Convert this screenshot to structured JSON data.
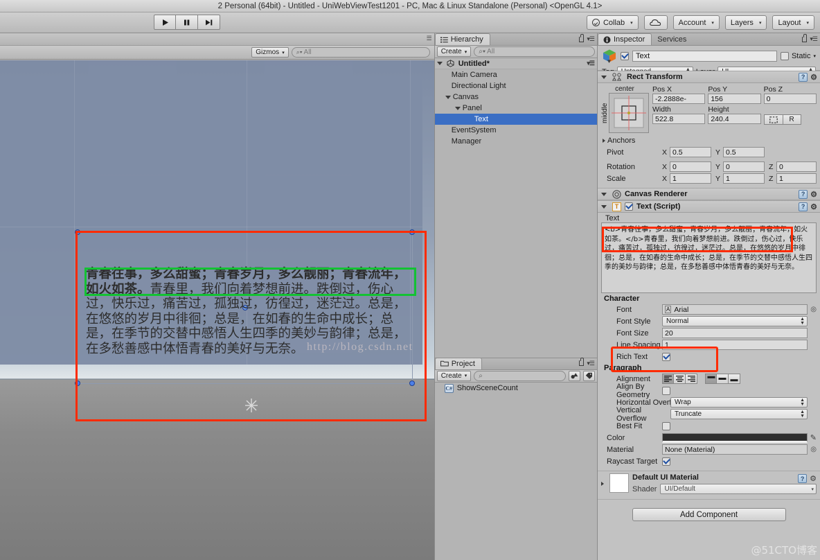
{
  "window": {
    "title": "2 Personal (64bit) - Untitled - UniWebViewTest1201 - PC, Mac & Linux Standalone (Personal) <OpenGL 4.1>"
  },
  "toolbar": {
    "play": "▶",
    "pause": "❙❙",
    "step": "▶❙",
    "collab": "Collab",
    "cloud_icon": "cloud-icon",
    "account": "Account",
    "layers": "Layers",
    "layout": "Layout",
    "caret": "▾"
  },
  "scene": {
    "gizmos": "Gizmos",
    "search_placeholder": "All",
    "search_prefix": "Q",
    "watermark": "http://blog.csdn.net",
    "text_bold": "青春往事，多么甜蜜；青春岁月，多么靓丽；青春流年，如火如茶。",
    "text_rest": "青春里，我们向着梦想前进。跌倒过，伤心过，快乐过，痛苦过，孤独过，彷徨过，迷茫过。总是，在悠悠的岁月中徘徊；总是，在如春的生命中成长；总是，在季节的交替中感悟人生四季的美妙与韵律；总是，在多愁善感中体悟青春的美好与无奈。"
  },
  "hierarchy": {
    "tab": "Hierarchy",
    "create": "Create",
    "search_placeholder": "All",
    "scene_name": "Untitled*",
    "items": [
      {
        "label": "Main Camera",
        "depth": 1,
        "expandable": false,
        "selected": false
      },
      {
        "label": "Directional Light",
        "depth": 1,
        "expandable": false,
        "selected": false
      },
      {
        "label": "Canvas",
        "depth": 1,
        "expandable": true,
        "selected": false
      },
      {
        "label": "Panel",
        "depth": 2,
        "expandable": true,
        "selected": false
      },
      {
        "label": "Text",
        "depth": 3,
        "expandable": false,
        "selected": true
      },
      {
        "label": "EventSystem",
        "depth": 1,
        "expandable": false,
        "selected": false
      },
      {
        "label": "Manager",
        "depth": 1,
        "expandable": false,
        "selected": false
      }
    ]
  },
  "project": {
    "tab": "Project",
    "create": "Create",
    "search_placeholder": "",
    "items": [
      {
        "label": "ShowSceneCount",
        "icon": "csharp-script-icon"
      }
    ]
  },
  "inspector": {
    "tab": "Inspector",
    "services_tab": "Services",
    "object_name": "Text",
    "object_enabled": true,
    "static_label": "Static",
    "tag_label": "Tag",
    "tag_value": "Untagged",
    "layer_label": "Layer",
    "layer_value": "UI",
    "rect_transform": {
      "title": "Rect Transform",
      "anchor_preset_top": "center",
      "anchor_preset_left": "middle",
      "headers": [
        "Pos X",
        "Pos Y",
        "Pos Z"
      ],
      "values": [
        "-2.2888e-",
        "156",
        "0"
      ],
      "size_headers": [
        "Width",
        "Height"
      ],
      "size_values": [
        "522.8",
        "240.4"
      ],
      "blueprint_label": "R",
      "anchors_label": "Anchors",
      "pivot_label": "Pivot",
      "pivot_x": "0.5",
      "pivot_y": "0.5",
      "rotation_label": "Rotation",
      "rotation": [
        "0",
        "0",
        "0"
      ],
      "scale_label": "Scale",
      "scale": [
        "1",
        "1",
        "1"
      ]
    },
    "canvas_renderer": {
      "title": "Canvas Renderer"
    },
    "text_script": {
      "title": "Text (Script)",
      "enabled": true,
      "text_label": "Text",
      "text_value": "<b>青春往事，多么甜蜜；青春岁月，多么靓丽；青春流年，如火如茶。</b>青春里，我们向着梦想前进。跌倒过，伤心过，快乐过，痛苦过，孤独过，彷徨过，迷茫过。总是，在悠悠的岁月中徘徊；总是，在如春的生命中成长；总是，在季节的交替中感悟人生四季的美妙与韵律；总是，在多愁善感中体悟青春的美好与无奈。",
      "character_label": "Character",
      "font_label": "Font",
      "font_value": "Arial",
      "font_style_label": "Font Style",
      "font_style_value": "Normal",
      "font_size_label": "Font Size",
      "font_size_value": "20",
      "line_spacing_label": "Line Spacing",
      "line_spacing_value": "1",
      "rich_text_label": "Rich Text",
      "rich_text_checked": true,
      "paragraph_label": "Paragraph",
      "alignment_label": "Alignment",
      "align_by_geometry_label": "Align By Geometry",
      "align_by_geometry_checked": false,
      "horizontal_overflow_label": "Horizontal Overflow",
      "horizontal_overflow_value": "Wrap",
      "vertical_overflow_label": "Vertical Overflow",
      "vertical_overflow_value": "Truncate",
      "best_fit_label": "Best Fit",
      "best_fit_checked": false,
      "color_label": "Color",
      "color_value": "#2e2e2e",
      "material_label": "Material",
      "material_value": "None (Material)",
      "raycast_target_label": "Raycast Target",
      "raycast_target_checked": true
    },
    "material_block": {
      "title": "Default UI Material",
      "shader_label": "Shader",
      "shader_value": "UI/Default"
    },
    "add_component": "Add Component"
  },
  "watermark_bottom_right": "@51CTO博客"
}
